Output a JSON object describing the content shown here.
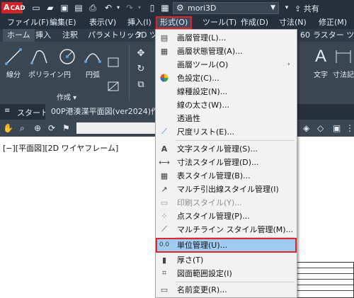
{
  "titlebar": {
    "logo": "CAD",
    "workspace": "mori3D",
    "share": "共有"
  },
  "menubar": {
    "items": [
      "ファイル(F)",
      "編集(E)",
      "表示(V)",
      "挿入(I)",
      "形式(O)",
      "ツール(T)",
      "作成(D)",
      "寸法(N)",
      "修正(M)"
    ]
  },
  "ribbon": {
    "tabs": [
      "ホーム",
      "挿入",
      "注釈",
      "パラメトリック",
      "3D ツー",
      "60",
      "ラスター ツール"
    ],
    "tools": {
      "line": "線分",
      "polyline": "ポリライン",
      "circle": "円",
      "arc": "円弧",
      "text": "文字",
      "dimension": "寸法記"
    },
    "panel_title": "作成 ▾"
  },
  "filetabs": {
    "start": "スタート",
    "document": "00P港湊渫平面図(ver2024)作成中"
  },
  "canvas": {
    "viewport_label": "[−][平面図][2D ワイヤフレーム]"
  },
  "dropdown": {
    "items": [
      {
        "label": "画層管理(L)...",
        "icon": "layers-icon"
      },
      {
        "label": "画層状態管理(A)...",
        "icon": "layer-state-icon"
      },
      {
        "label": "画層ツール(O)",
        "icon": "layer-tools-icon",
        "submenu": true
      },
      {
        "label": "色設定(C)...",
        "icon": "color-wheel-icon"
      },
      {
        "label": "線種設定(N)...",
        "icon": "linetype-icon"
      },
      {
        "label": "線の太さ(W)...",
        "icon": "lineweight-icon"
      },
      {
        "label": "透過性",
        "icon": "transparency-icon"
      },
      {
        "label": "尺度リスト(E)...",
        "icon": "scale-list-icon"
      },
      {
        "label": "文字スタイル管理(S)...",
        "icon": "text-style-icon"
      },
      {
        "label": "寸法スタイル管理(D)...",
        "icon": "dim-style-icon"
      },
      {
        "label": "表スタイル管理(B)...",
        "icon": "table-style-icon"
      },
      {
        "label": "マルチ引出線スタイル管理(I)",
        "icon": "mleader-style-icon"
      },
      {
        "label": "印刷スタイル(Y)...",
        "icon": "plot-style-icon",
        "disabled": true
      },
      {
        "label": "点スタイル管理(P)...",
        "icon": "point-style-icon"
      },
      {
        "label": "マルチライン スタイル管理(M)...",
        "icon": "mline-style-icon"
      },
      {
        "label": "単位管理(U)...",
        "icon": "units-icon",
        "highlight": true
      },
      {
        "label": "厚さ(T)",
        "icon": "thickness-icon"
      },
      {
        "label": "図面範囲設定(I)",
        "icon": "limits-icon"
      },
      {
        "label": "名前変更(R)...",
        "icon": "rename-icon"
      }
    ]
  },
  "colors": {
    "title_bg": "#26303d",
    "ribbon_bg": "#3b4653",
    "highlight_border": "#e0262c",
    "highlight_fill": "#9fcbf0"
  }
}
